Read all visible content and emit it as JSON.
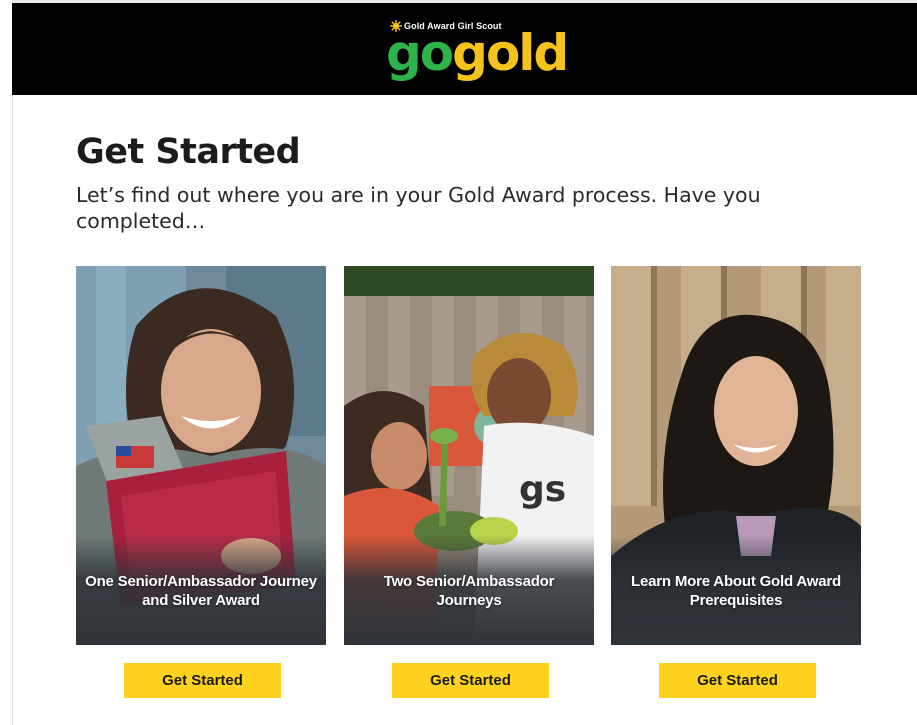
{
  "header": {
    "logo_tagline": "Gold Award Girl Scout",
    "logo_go": "go",
    "logo_gold": "gold"
  },
  "main": {
    "title": "Get Started",
    "subtitle": "Let’s find out where you are in your Gold Award process. Have you completed…"
  },
  "cards": [
    {
      "label": "One Senior/Ambassador Journey and Silver Award",
      "button": "Get Started"
    },
    {
      "label": "Two Senior/Ambassador Journeys",
      "button": "Get Started"
    },
    {
      "label": "Learn More About Gold Award Prerequisites",
      "button": "Get Started"
    }
  ],
  "colors": {
    "header_bg": "#000000",
    "logo_green": "#2cb34a",
    "logo_gold": "#f6c31c",
    "button_bg": "#ffd21f",
    "card_overlay": "#2f3439"
  }
}
